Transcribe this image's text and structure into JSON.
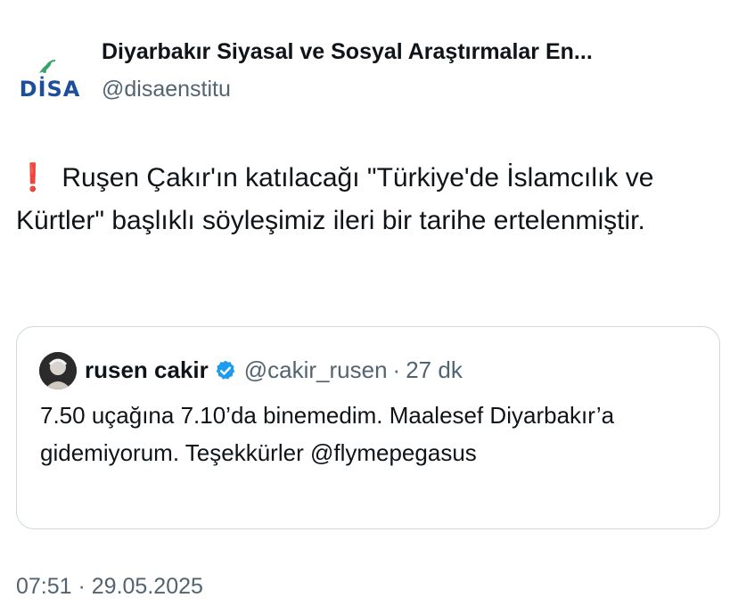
{
  "author": {
    "display_name": "Diyarbakır Siyasal ve Sosyal Araştırmalar En...",
    "handle": "@disaenstitu",
    "avatar_logo_text": "DİSA"
  },
  "tweet": {
    "alert_glyph": "❗",
    "text": "Ruşen Çakır'ın katılacağı \"Türkiye'de İslamcılık ve Kürtler\" başlıklı söyleşimiz ileri bir tarihe ertelenmiştir."
  },
  "quoted_tweet": {
    "name": "rusen cakir",
    "handle": "@cakir_rusen",
    "separator": "·",
    "time": "27 dk",
    "text": "7.50 uçağına 7.10’da binemedim. Maalesef Diyarbakır’a gidemiyorum. Teşekkürler @flymepegasus"
  },
  "timestamp": "07:51 · 29.05.2025",
  "colors": {
    "text_primary": "#0f1419",
    "text_secondary": "#536471",
    "border": "#cfd9de",
    "verified": "#1d9bf0",
    "alert": "#e0202e",
    "logo_blue": "#1b4f9c",
    "logo_green": "#3aa36a"
  }
}
